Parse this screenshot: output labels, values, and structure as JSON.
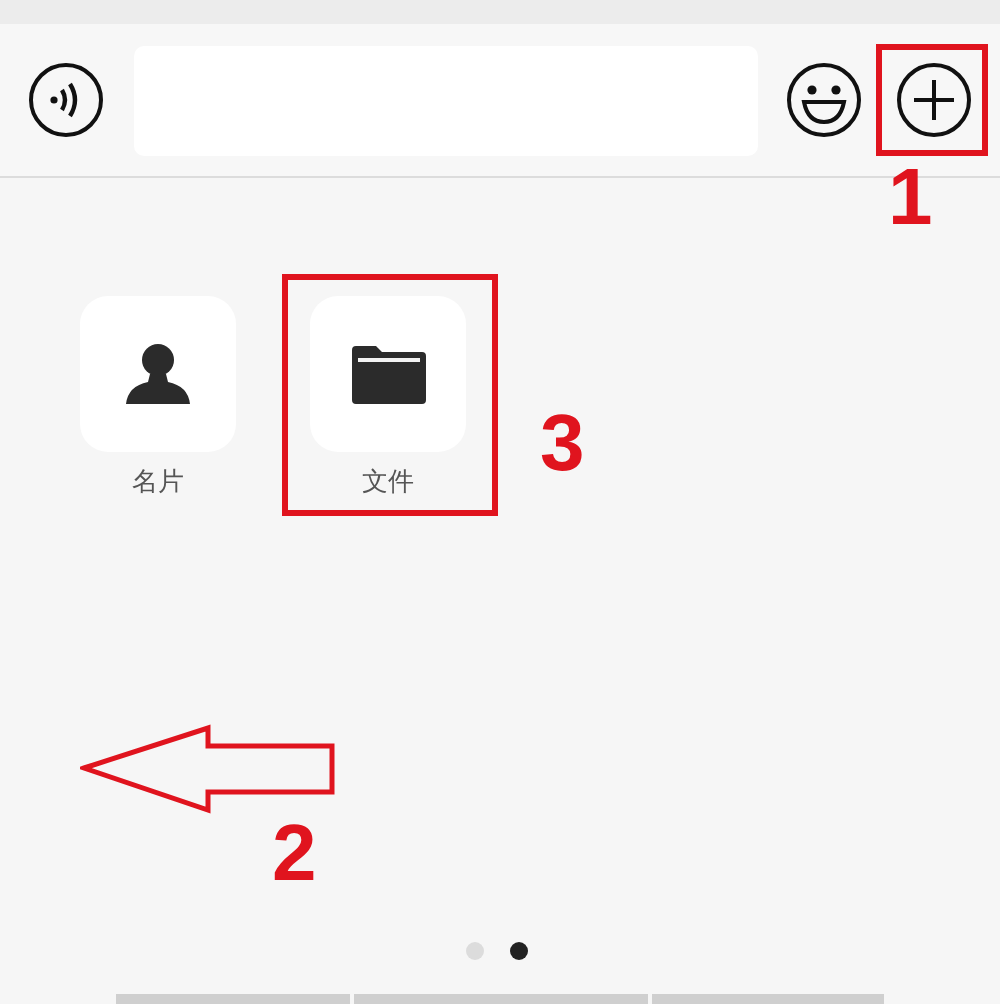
{
  "input_bar": {
    "buttons": [
      {
        "kind": "voice"
      },
      {
        "kind": "emoji"
      },
      {
        "kind": "plus"
      }
    ]
  },
  "panel": {
    "items": [
      {
        "kind": "contact",
        "label": "名片"
      },
      {
        "kind": "file",
        "label": "文件"
      }
    ]
  },
  "page_dots": [
    {
      "selected": false
    },
    {
      "selected": true
    }
  ],
  "annotations": [
    {
      "kind": "plus_box",
      "number": "1"
    },
    {
      "kind": "arrow",
      "number": "2"
    },
    {
      "kind": "file_box",
      "number": "3"
    }
  ]
}
